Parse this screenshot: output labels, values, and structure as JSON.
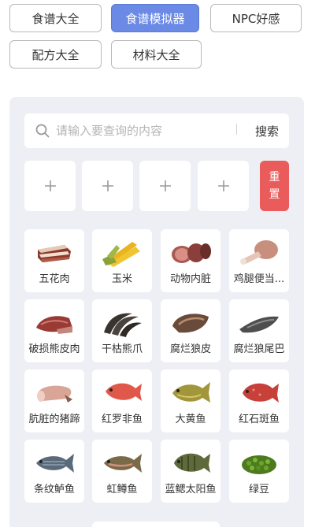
{
  "tabs": [
    {
      "label": "食谱大全",
      "active": false
    },
    {
      "label": "食谱模拟器",
      "active": true
    },
    {
      "label": "NPC好感",
      "active": false
    },
    {
      "label": "配方大全",
      "active": false
    },
    {
      "label": "材料大全",
      "active": false
    }
  ],
  "search": {
    "placeholder": "请输入要查询的内容",
    "button_label": "搜索"
  },
  "slots": [
    {
      "symbol": "plus-icon"
    },
    {
      "symbol": "plus-icon"
    },
    {
      "symbol": "plus-icon"
    },
    {
      "symbol": "plus-icon"
    }
  ],
  "reset": {
    "line1": "重",
    "line2": "置"
  },
  "ingredients": [
    {
      "name": "五花肉",
      "icon": "pork-belly-icon"
    },
    {
      "name": "玉米",
      "icon": "corn-icon"
    },
    {
      "name": "动物内脏",
      "icon": "sausage-icon"
    },
    {
      "name": "鸡腿便当...",
      "icon": "chicken-leg-icon"
    },
    {
      "name": "破损熊皮肉",
      "icon": "bear-meat-icon"
    },
    {
      "name": "干枯熊爪",
      "icon": "bear-claw-icon"
    },
    {
      "name": "腐烂狼皮",
      "icon": "wolf-pelt-icon"
    },
    {
      "name": "腐烂狼尾巴",
      "icon": "wolf-tail-icon"
    },
    {
      "name": "肮脏的猪蹄",
      "icon": "pig-trotter-icon"
    },
    {
      "name": "红罗非鱼",
      "icon": "red-tilapia-icon"
    },
    {
      "name": "大黄鱼",
      "icon": "yellow-croaker-icon"
    },
    {
      "name": "红石斑鱼",
      "icon": "red-grouper-icon"
    },
    {
      "name": "条纹鲈鱼",
      "icon": "striped-bass-icon"
    },
    {
      "name": "虹鳟鱼",
      "icon": "rainbow-trout-icon"
    },
    {
      "name": "蓝鳃太阳鱼",
      "icon": "bluegill-icon"
    },
    {
      "name": "绿豆",
      "icon": "mung-bean-icon"
    }
  ],
  "colors": {
    "accent": "#6b8ae6",
    "reset": "#ea5b5b",
    "panel": "#eeeff4"
  }
}
